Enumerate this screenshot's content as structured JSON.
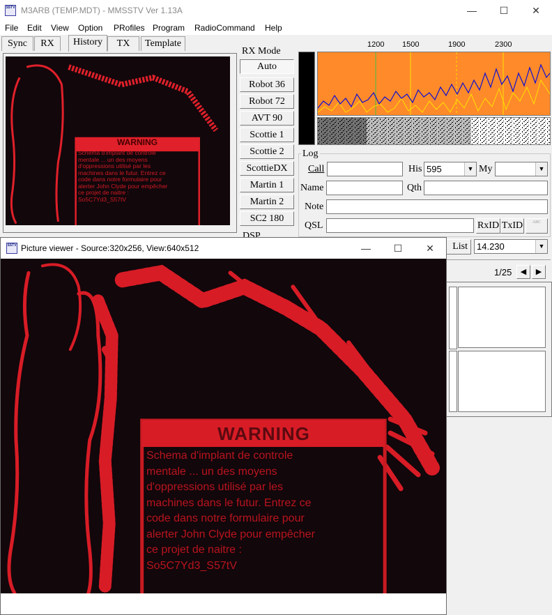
{
  "window": {
    "title": "M3ARB (TEMP.MDT) - MMSSTV Ver 1.13A",
    "icon_text": "SSTV",
    "controls": {
      "minimize": "—",
      "maximize": "☐",
      "close": "✕"
    }
  },
  "menu": [
    "File",
    "Edit",
    "View",
    "Option",
    "PRofiles",
    "Program",
    "RadioCommand",
    "Help"
  ],
  "tabs": [
    "Sync",
    "RX",
    "History",
    "TX",
    "Template"
  ],
  "active_tab": "History",
  "rx_mode": {
    "label": "RX Mode",
    "buttons": [
      "Auto",
      "Robot 36",
      "Robot 72",
      "AVT 90",
      "Scottie 1",
      "Scottie 2",
      "ScottieDX",
      "Martin 1",
      "Martin 2",
      "SC2 180"
    ],
    "selected": "Auto",
    "dsp_label": "DSP"
  },
  "spectrum": {
    "freq_labels": [
      "1200",
      "1500",
      "1900",
      "2300"
    ],
    "colors": {
      "background": "#ff8a2a",
      "trace_blue": "#1010d0",
      "trace_yellow": "#ffe000",
      "marker_green": "#40c040"
    }
  },
  "log": {
    "title": "Log",
    "call_label": "Call",
    "call_value": "",
    "his_label": "His",
    "his_value": "595",
    "my_label": "My",
    "my_value": "",
    "name_label": "Name",
    "name_value": "",
    "qth_label": "Qth",
    "qth_value": "",
    "note_label": "Note",
    "note_value": "",
    "qsl_label": "QSL",
    "qsl_value": "",
    "rxid_button": "RxID",
    "txid_button": "TxID",
    "abc_button": "ABC",
    "list_button": "List",
    "freq_value": "14.230"
  },
  "history": {
    "page": "1/25",
    "prev": "◀",
    "next": "▶"
  },
  "image": {
    "warning_title": "WARNING",
    "warning_lines": [
      "Schema d'implant de controle",
      "mentale ... un des moyens",
      "d'oppressions utilisé par les",
      "machines dans le futur. Entrez ce",
      "code dans notre formulaire pour",
      "alerter John Clyde pour empêcher",
      "ce projet de naitre :",
      "So5C7Yd3_S57tV"
    ],
    "colors": {
      "bg": "#12070b",
      "red": "#e0202a"
    }
  },
  "viewer": {
    "title": "Picture viewer - Source:320x256, View:640x512",
    "icon_text": "SSTV",
    "controls": {
      "minimize": "—",
      "maximize": "☐",
      "close": "✕"
    }
  }
}
